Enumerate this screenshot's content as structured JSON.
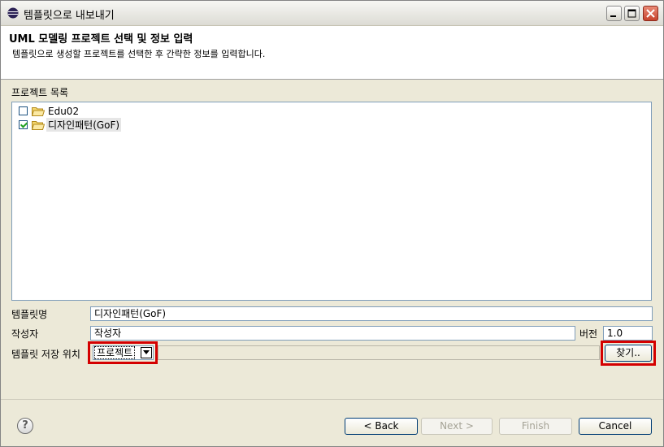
{
  "window": {
    "title": "템플릿으로 내보내기"
  },
  "header": {
    "title": "UML 모델링 프로젝트 선택 및 정보 입력",
    "subtitle": "템플릿으로 생성할 프로젝트를 선택한 후 간략한 정보를 입력합니다."
  },
  "projects": {
    "label": "프로젝트 목록",
    "items": [
      {
        "name": "Edu02",
        "checked": false
      },
      {
        "name": "디자인패턴(GoF)",
        "checked": true
      }
    ]
  },
  "form": {
    "template_name_label": "템플릿명",
    "template_name_value": "디자인패턴(GoF)",
    "author_label": "작성자",
    "author_value": "작성자",
    "version_label": "버전",
    "version_value": "1.0",
    "location_label": "템플릿 저장 위치",
    "location_selected": "프로젝트",
    "browse_label": "찾기.."
  },
  "buttons": {
    "back": "< Back",
    "next": "Next >",
    "finish": "Finish",
    "cancel": "Cancel"
  },
  "colors": {
    "highlight": "#d40000"
  }
}
